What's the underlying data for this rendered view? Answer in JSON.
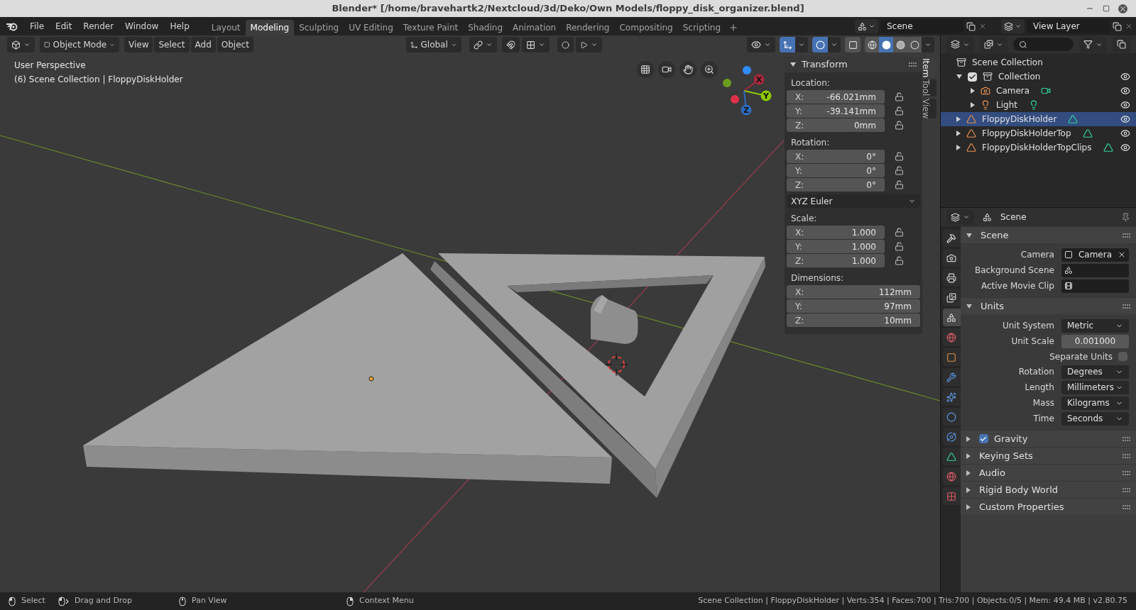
{
  "window": {
    "title": "Blender* [/home/bravehartk2/Nextcloud/3d/Deko/Own Models/floppy_disk_organizer.blend]"
  },
  "menu": [
    "File",
    "Edit",
    "Render",
    "Window",
    "Help"
  ],
  "workspaces": [
    {
      "label": "Layout",
      "selected": false
    },
    {
      "label": "Modeling",
      "selected": true
    },
    {
      "label": "Sculpting",
      "selected": false
    },
    {
      "label": "UV Editing",
      "selected": false
    },
    {
      "label": "Texture Paint",
      "selected": false
    },
    {
      "label": "Shading",
      "selected": false
    },
    {
      "label": "Animation",
      "selected": false
    },
    {
      "label": "Rendering",
      "selected": false
    },
    {
      "label": "Compositing",
      "selected": false
    },
    {
      "label": "Scripting",
      "selected": false
    }
  ],
  "scene_selector": {
    "value": "Scene"
  },
  "view_layer_selector": {
    "value": "View Layer"
  },
  "viewport": {
    "mode": "Object Mode",
    "menus": [
      "View",
      "Select",
      "Add",
      "Object"
    ],
    "orientation": "Global",
    "toggles": [
      {
        "kind": "gizmo",
        "on": true
      },
      {
        "kind": "overlay",
        "on": true
      },
      {
        "kind": "xray",
        "on": false
      }
    ],
    "shading": [
      {
        "kind": "wireframe",
        "selected": false
      },
      {
        "kind": "solid",
        "selected": true
      },
      {
        "kind": "material",
        "selected": false
      },
      {
        "kind": "rendered",
        "selected": false
      }
    ],
    "info": [
      "User Perspective",
      "(6) Scene Collection | FloppyDiskHolder"
    ],
    "gizmo": [
      {
        "label": "X",
        "color": "#a8283c"
      },
      {
        "label": "Y",
        "color": "#8ec600"
      },
      {
        "label": "Z",
        "color": "#2c6cbd"
      }
    ]
  },
  "sidebar": {
    "tabs": [
      {
        "label": "Item",
        "selected": true
      },
      {
        "label": "Tool",
        "selected": false
      },
      {
        "label": "View",
        "selected": false
      }
    ],
    "panel": {
      "title": "Transform",
      "expanded": true
    },
    "groups": [
      {
        "label": "Location:",
        "fields": [
          {
            "axis": "X:",
            "value": "-66.021mm",
            "locked": false
          },
          {
            "axis": "Y:",
            "value": "-39.141mm",
            "locked": false
          },
          {
            "axis": "Z:",
            "value": "0mm",
            "locked": false
          }
        ]
      },
      {
        "label": "Rotation:",
        "fields": [
          {
            "axis": "X:",
            "value": "0°",
            "locked": false
          },
          {
            "axis": "Y:",
            "value": "0°",
            "locked": false
          },
          {
            "axis": "Z:",
            "value": "0°",
            "locked": false
          }
        ],
        "mode": "XYZ Euler"
      },
      {
        "label": "Scale:",
        "fields": [
          {
            "axis": "X:",
            "value": "1.000",
            "locked": false
          },
          {
            "axis": "Y:",
            "value": "1.000",
            "locked": false
          },
          {
            "axis": "Z:",
            "value": "1.000",
            "locked": false
          }
        ]
      },
      {
        "label": "Dimensions:",
        "fields": [
          {
            "axis": "X:",
            "value": "112mm"
          },
          {
            "axis": "Y:",
            "value": "97mm"
          },
          {
            "axis": "Z:",
            "value": "10mm"
          }
        ]
      }
    ]
  },
  "outliner": {
    "root": "Scene Collection",
    "items": [
      {
        "name": "Collection",
        "kind": "collection",
        "checked": true,
        "expanded": true,
        "selected": false,
        "visible": true,
        "children": [
          {
            "name": "Camera",
            "kind": "camera",
            "expanded": false,
            "selected": false,
            "visible": true
          },
          {
            "name": "Light",
            "kind": "light",
            "expanded": false,
            "selected": false,
            "visible": true
          }
        ]
      },
      {
        "name": "FloppyDiskHolder",
        "kind": "mesh",
        "expanded": false,
        "selected": true,
        "visible": true
      },
      {
        "name": "FloppyDiskHolderTop",
        "kind": "mesh",
        "expanded": false,
        "selected": false,
        "visible": true
      },
      {
        "name": "FloppyDiskHolderTopClips",
        "kind": "mesh",
        "expanded": false,
        "selected": false,
        "visible": true
      }
    ]
  },
  "properties": {
    "context": "Scene",
    "tabs": [
      {
        "kind": "tool",
        "selected": false
      },
      {
        "kind": "render",
        "selected": false
      },
      {
        "kind": "output",
        "selected": false
      },
      {
        "kind": "view_layer",
        "selected": false
      },
      {
        "kind": "scene",
        "selected": true
      },
      {
        "kind": "world",
        "selected": false
      },
      {
        "kind": "object",
        "selected": false
      },
      {
        "kind": "modifiers",
        "selected": false
      },
      {
        "kind": "particles",
        "selected": false
      },
      {
        "kind": "physics",
        "selected": false
      },
      {
        "kind": "constraints",
        "selected": false
      },
      {
        "kind": "data",
        "selected": false
      },
      {
        "kind": "material",
        "selected": false
      },
      {
        "kind": "texture",
        "selected": false
      }
    ],
    "panels": [
      {
        "title": "Scene",
        "expanded": true,
        "fields": [
          {
            "label": "Camera",
            "kind": "object",
            "value": "Camera"
          },
          {
            "label": "Background Scene",
            "kind": "scene"
          },
          {
            "label": "Active Movie Clip",
            "kind": "clip"
          }
        ]
      },
      {
        "title": "Units",
        "expanded": true,
        "fields": [
          {
            "label": "Unit System",
            "kind": "dropdown",
            "value": "Metric"
          },
          {
            "label": "Unit Scale",
            "kind": "number",
            "value": "0.001000"
          },
          {
            "label": "Separate Units",
            "kind": "checkbox",
            "checked": false
          },
          {
            "label": "Rotation",
            "kind": "dropdown",
            "value": "Degrees"
          },
          {
            "label": "Length",
            "kind": "dropdown",
            "value": "Millimeters"
          },
          {
            "label": "Mass",
            "kind": "dropdown",
            "value": "Kilograms"
          },
          {
            "label": "Time",
            "kind": "dropdown",
            "value": "Seconds"
          }
        ]
      },
      {
        "title": "Gravity",
        "expanded": false,
        "checked": true
      },
      {
        "title": "Keying Sets",
        "expanded": false
      },
      {
        "title": "Audio",
        "expanded": false
      },
      {
        "title": "Rigid Body World",
        "expanded": false
      },
      {
        "title": "Custom Properties",
        "expanded": false
      }
    ]
  },
  "status": {
    "hints": [
      {
        "kind": "left",
        "label": "Select"
      },
      {
        "kind": "drag",
        "label": "Drag and Drop"
      },
      {
        "kind": "middle",
        "label": "Pan View"
      },
      {
        "kind": "right",
        "label": "Context Menu"
      }
    ],
    "stats": "Scene Collection | FloppyDiskHolder | Verts:354 | Faces:700 | Tris:700 | Objects:0/5 | Mem: 49.4 MB | v2.80.75"
  }
}
